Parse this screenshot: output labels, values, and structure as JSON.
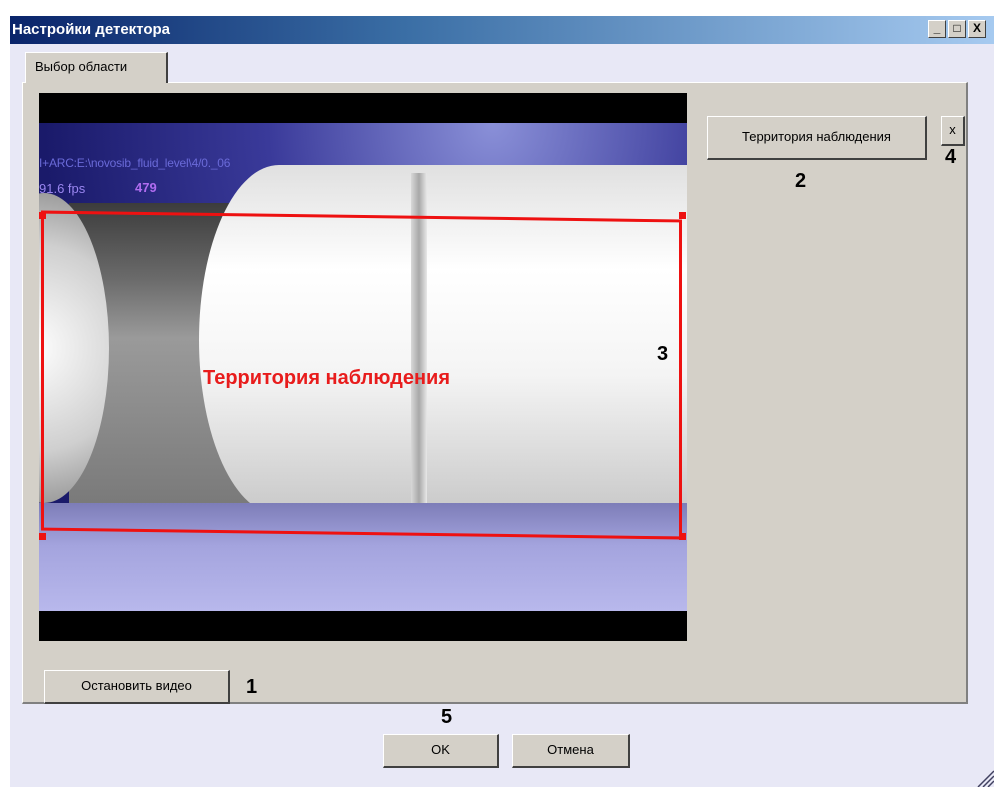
{
  "window": {
    "title": "Настройки детектора",
    "controls": {
      "minimize": "_",
      "maximize": "□",
      "close": "X"
    }
  },
  "tabs": [
    {
      "label": "Выбор области",
      "selected": true
    }
  ],
  "video": {
    "source_text": "I+ARC:E:\\novosib_fluid_level\\4/0._06",
    "fps_text": "91.6 fps",
    "frame_counter": "479",
    "region_label": "Территория наблюдения",
    "region_color": "#ee1111"
  },
  "buttons": {
    "territory": "Территория наблюдения",
    "delete": "x",
    "stop_video": "Остановить видео",
    "ok": "OK",
    "cancel": "Отмена"
  },
  "callouts": {
    "n1": "1",
    "n2": "2",
    "n3": "3",
    "n4": "4",
    "n5": "5"
  }
}
